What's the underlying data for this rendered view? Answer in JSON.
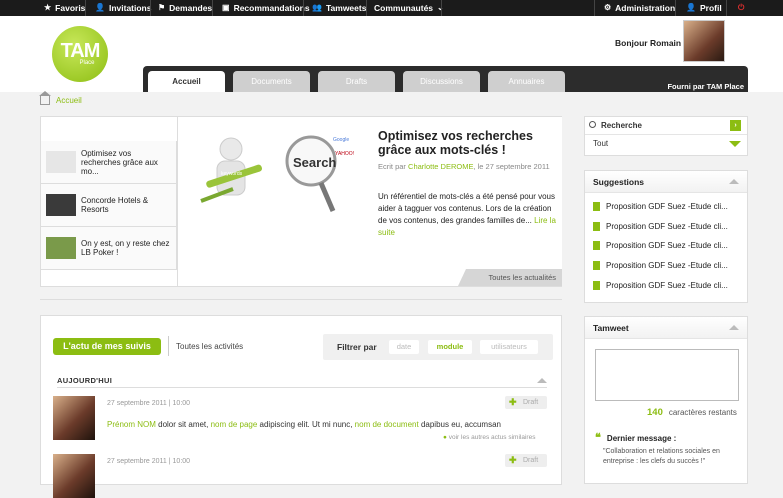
{
  "topbar": {
    "favoris": "Favoris",
    "invitations": "Invitations",
    "demandes": "Demandes",
    "recommandations": "Recommandations",
    "tamweets": "Tamweets",
    "communautes": "Communautés",
    "administration": "Administration",
    "profil": "Profil"
  },
  "logo": {
    "tam": "TAM",
    "place": "Place"
  },
  "header": {
    "greeting": "Bonjour Romain !",
    "powered": "Fourni par TAM Place"
  },
  "tabs": [
    {
      "label": "Accueil"
    },
    {
      "label": "Documents"
    },
    {
      "label": "Drafts"
    },
    {
      "label": "Discussions"
    },
    {
      "label": "Annuaires"
    }
  ],
  "breadcrumb": {
    "home": "Accueil"
  },
  "featured": {
    "list": [
      {
        "label": "Optimisez vos recherches grâce aux mo..."
      },
      {
        "label": "Concorde Hotels & Resorts"
      },
      {
        "label": "On y est, on y reste chez LB Poker !"
      }
    ],
    "title": "Optimisez vos recherches grâce aux mots-clés !",
    "meta_prefix": "Ecrit par",
    "author": "Charlotte DEROME",
    "meta_suffix": ", le 27 septembre 2011",
    "body": "Un référentiel de mots-clés a été pensé pour vous aider à tagguer vos contenus. Lors de la création de vos contenus, des grandes familles de...",
    "more": "Lire la suite",
    "footer": "Toutes les actualités",
    "image_words": {
      "search": "Search",
      "keywords": "keywords",
      "google": "Google",
      "yahoo": "YAHOO!"
    }
  },
  "activity": {
    "tab_active": "L'actu de mes suivis",
    "tab_all": "Toutes les activités",
    "filter_label": "Filtrer par",
    "filters": [
      {
        "label": "date",
        "active": false
      },
      {
        "label": "module",
        "active": true
      },
      {
        "label": "utilisateurs",
        "active": false
      }
    ],
    "day": "AUJOURD'HUI",
    "posts": [
      {
        "date": "27 septembre 2011",
        "time": "10:00",
        "draft": "Draft",
        "name": "Prénom NOM",
        "t1": " dolor sit amet, ",
        "page": "nom de page",
        "t2": " adipiscing elit. Ut mi nunc, ",
        "doc": "nom de document",
        "t3": " dapibus eu, accumsan",
        "similar": "voir les autres actus similaires"
      },
      {
        "date": "27 septembre 2011",
        "time": "10:00",
        "draft": "Draft"
      }
    ]
  },
  "search": {
    "title": "Recherche",
    "scope": "Tout"
  },
  "suggestions": {
    "title": "Suggestions",
    "items": [
      "Proposition GDF Suez -Etude cli...",
      "Proposition GDF Suez -Etude cli...",
      "Proposition GDF Suez -Etude cli...",
      "Proposition GDF Suez -Etude cli...",
      "Proposition GDF Suez -Etude cli..."
    ]
  },
  "tamweet": {
    "title": "Tamweet",
    "count": "140",
    "count_label": "caractères restants",
    "last_label": "Dernier message :",
    "last_text": "\"Collaboration et relations sociales en entreprise : les clefs du succès !\""
  },
  "colors": {
    "accent": "#8cbd12",
    "topbar": "#1b1b1b",
    "tabbar": "#2c2c2c"
  }
}
